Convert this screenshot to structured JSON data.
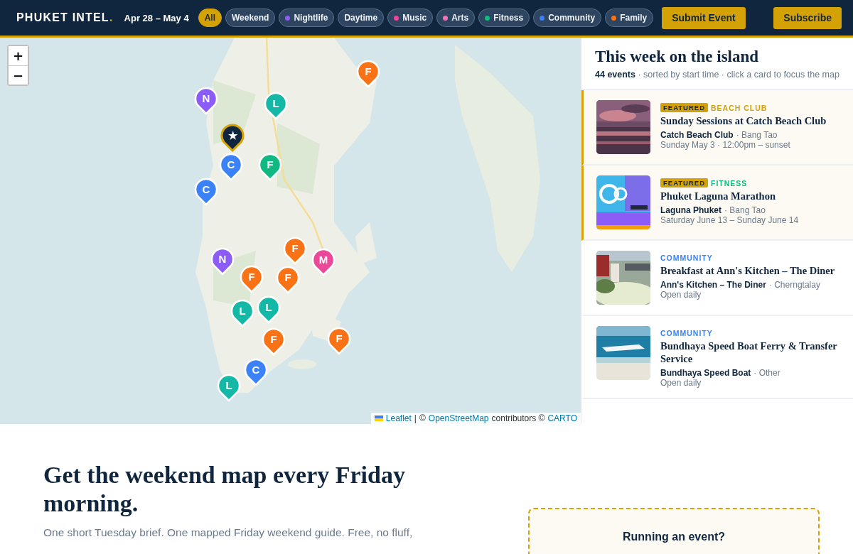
{
  "header": {
    "logo": "PHUKET INTEL",
    "logo_mark": ".",
    "date_range": "Apr 28 – May 4",
    "filters": [
      {
        "label": "All",
        "selected": true
      },
      {
        "label": "Weekend",
        "selected": false
      },
      {
        "label": "Nightlife",
        "selected": false,
        "color": "#8b5cf6"
      },
      {
        "label": "Daytime",
        "selected": false
      },
      {
        "label": "Music",
        "selected": false,
        "color": "#ec4899"
      },
      {
        "label": "Arts",
        "selected": false,
        "color": "#f472b6"
      },
      {
        "label": "Fitness",
        "selected": false,
        "color": "#10b981"
      },
      {
        "label": "Community",
        "selected": false,
        "color": "#3b82f6"
      },
      {
        "label": "Family",
        "selected": false,
        "color": "#f97316"
      }
    ],
    "buttons": [
      "Submit Event",
      "Subscribe"
    ]
  },
  "map": {
    "zoom_in": "+",
    "zoom_out": "−",
    "markers": [
      {
        "letter": "F",
        "color": "#f97316",
        "featured": false
      },
      {
        "letter": "N",
        "color": "#8b5cf6",
        "featured": false
      },
      {
        "letter": "L",
        "color": "#14b8a6",
        "featured": false
      },
      {
        "letter": "★",
        "color": "#10263f",
        "featured": true
      },
      {
        "letter": "C",
        "color": "#3b82f6",
        "featured": false
      },
      {
        "letter": "F",
        "color": "#10b981",
        "featured": false
      },
      {
        "letter": "C",
        "color": "#3b82f6",
        "featured": false
      },
      {
        "letter": "N",
        "color": "#8b5cf6",
        "featured": false
      },
      {
        "letter": "F",
        "color": "#f97316",
        "featured": false
      },
      {
        "letter": "M",
        "color": "#ec4899",
        "featured": false
      },
      {
        "letter": "F",
        "color": "#f97316",
        "featured": false
      },
      {
        "letter": "F",
        "color": "#f97316",
        "featured": false
      },
      {
        "letter": "L",
        "color": "#14b8a6",
        "featured": false
      },
      {
        "letter": "L",
        "color": "#14b8a6",
        "featured": false
      },
      {
        "letter": "F",
        "color": "#f97316",
        "featured": false
      },
      {
        "letter": "F",
        "color": "#f97316",
        "featured": false
      },
      {
        "letter": "C",
        "color": "#3b82f6",
        "featured": false
      },
      {
        "letter": "L",
        "color": "#14b8a6",
        "featured": false
      }
    ],
    "attribution": {
      "leaflet": "Leaflet",
      "separator": "|",
      "copyright": "©",
      "osm": "OpenStreetMap",
      "contributors": "contributors ©",
      "carto": "CARTO"
    }
  },
  "sidebar": {
    "title": "This week on the island",
    "subtitle": "**44 events** · sorted by start time · click a card to focus the map",
    "events": [
      {
        "featured": true,
        "badge": "FEATURED",
        "category": "BEACH CLUB",
        "color": "#d4a106",
        "title": "Sunday Sessions at Catch Beach Club",
        "venue": "Catch Beach Club",
        "area": "· Bang Tao",
        "time": "Sunday May 3 · 12:00pm – sunset"
      },
      {
        "featured": true,
        "badge": "FEATURED",
        "category": "FITNESS",
        "color": "#10b981",
        "title": "Phuket Laguna Marathon",
        "venue": "Laguna Phuket",
        "area": "· Bang Tao",
        "time": "Saturday June 13 – Sunday June 14"
      },
      {
        "featured": false,
        "category": "COMMUNITY",
        "color": "#3b82f6",
        "title": "Breakfast at Ann's Kitchen – The Diner",
        "venue": "Ann's Kitchen – The Diner",
        "area": "· Cherngtalay",
        "time": "Open daily"
      },
      {
        "featured": false,
        "category": "COMMUNITY",
        "color": "#3b82f6",
        "title": "Bundhaya Speed Boat Ferry & Transfer Service",
        "venue": "Bundhaya Speed Boat",
        "area": "· Other",
        "time": "Open daily"
      }
    ]
  },
  "newsletter": {
    "heading": "Get the weekend map every Friday morning.",
    "text": "One short Tuesday brief. One mapped Friday weekend guide. Free, no fluff,"
  },
  "promo": {
    "title": "Running an event?"
  }
}
